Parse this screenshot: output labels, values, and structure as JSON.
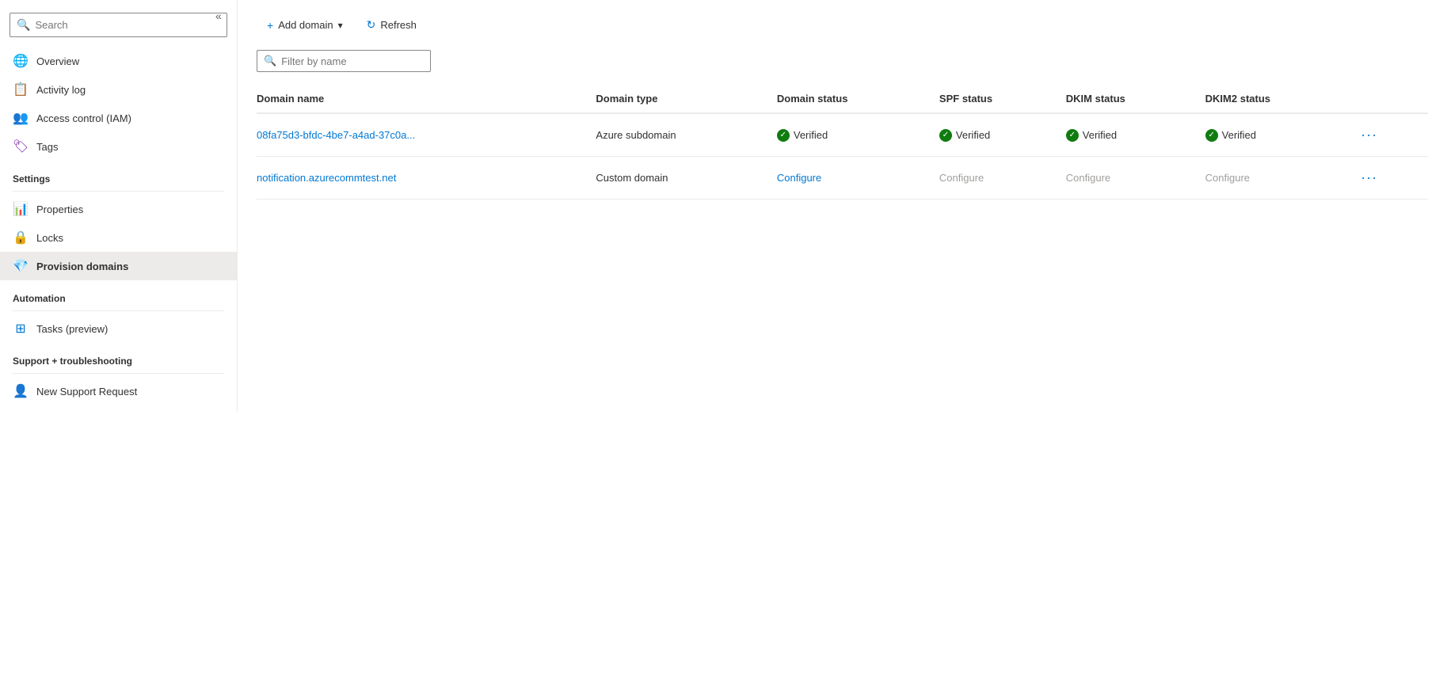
{
  "sidebar": {
    "search": {
      "placeholder": "Search",
      "value": ""
    },
    "collapse_label": "«",
    "nav_items": [
      {
        "id": "overview",
        "label": "Overview",
        "icon": "globe"
      },
      {
        "id": "activity-log",
        "label": "Activity log",
        "icon": "list"
      },
      {
        "id": "access-control",
        "label": "Access control (IAM)",
        "icon": "people"
      },
      {
        "id": "tags",
        "label": "Tags",
        "icon": "tag"
      }
    ],
    "sections": [
      {
        "title": "Settings",
        "items": [
          {
            "id": "properties",
            "label": "Properties",
            "icon": "bars"
          },
          {
            "id": "locks",
            "label": "Locks",
            "icon": "lock"
          },
          {
            "id": "provision-domains",
            "label": "Provision domains",
            "icon": "diamond",
            "active": true
          }
        ]
      },
      {
        "title": "Automation",
        "items": [
          {
            "id": "tasks",
            "label": "Tasks (preview)",
            "icon": "grid"
          }
        ]
      },
      {
        "title": "Support + troubleshooting",
        "items": [
          {
            "id": "new-support",
            "label": "New Support Request",
            "icon": "person-circle"
          }
        ]
      }
    ]
  },
  "toolbar": {
    "add_domain_label": "Add domain",
    "add_domain_icon": "+",
    "chevron_down": "▾",
    "refresh_label": "Refresh",
    "refresh_icon": "↻"
  },
  "filter": {
    "placeholder": "Filter by name",
    "value": ""
  },
  "table": {
    "columns": [
      {
        "id": "domain-name",
        "label": "Domain name"
      },
      {
        "id": "domain-type",
        "label": "Domain type"
      },
      {
        "id": "domain-status",
        "label": "Domain status"
      },
      {
        "id": "spf-status",
        "label": "SPF status"
      },
      {
        "id": "dkim-status",
        "label": "DKIM status"
      },
      {
        "id": "dkim2-status",
        "label": "DKIM2 status"
      }
    ],
    "rows": [
      {
        "id": "row-1",
        "domain_name": "08fa75d3-bfdc-4be7-a4ad-37c0a...",
        "domain_name_full": "08fa75d3-bfdc-4be7-a4ad-37c0a",
        "domain_type": "Azure subdomain",
        "domain_status": "Verified",
        "domain_status_type": "verified",
        "spf_status": "Verified",
        "spf_status_type": "verified",
        "dkim_status": "Verified",
        "dkim_status_type": "verified",
        "dkim2_status": "Verified",
        "dkim2_status_type": "verified"
      },
      {
        "id": "row-2",
        "domain_name": "notification.azurecommtest.net",
        "domain_type": "Custom domain",
        "domain_status": "Configure",
        "domain_status_type": "configure-link",
        "spf_status": "Configure",
        "spf_status_type": "configure-grey",
        "dkim_status": "Configure",
        "dkim_status_type": "configure-grey",
        "dkim2_status": "Configure",
        "dkim2_status_type": "configure-grey"
      }
    ]
  }
}
